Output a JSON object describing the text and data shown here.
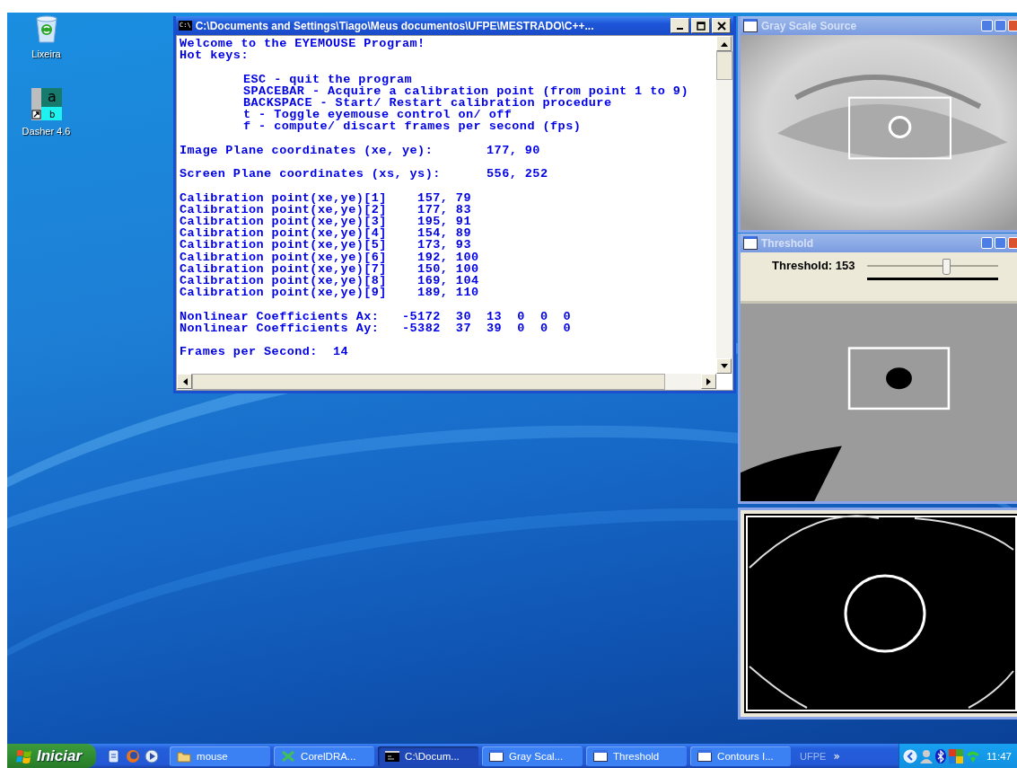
{
  "desktop_icons": [
    {
      "kind": "recycle",
      "label": "Lixeira"
    },
    {
      "kind": "dasher",
      "label": "Dasher 4.6",
      "glyphs": [
        "a",
        "b"
      ]
    }
  ],
  "console": {
    "icon_text": "C:\\",
    "title": "C:\\Documents and Settings\\Tiago\\Meus documentos\\UFPE\\MESTRADO\\C++...",
    "sections": [
      {
        "indent": false,
        "lines": [
          "Welcome to the EYEMOUSE Program!",
          "Hot keys:"
        ]
      },
      {
        "indent": true,
        "lines": [
          "ESC - quit the program",
          "SPACEBAR - Acquire a calibration point (from point 1 to 9)",
          "BACKSPACE - Start/ Restart calibration procedure",
          "t - Toggle eyemouse control on/ off",
          "f - compute/ discart frames per second (fps)"
        ]
      },
      {
        "indent": false,
        "lines": [
          "Image Plane coordinates (xe, ye):       177, 90"
        ]
      },
      {
        "indent": false,
        "lines": [
          "Screen Plane coordinates (xs, ys):      556, 252"
        ]
      },
      {
        "indent": false,
        "lines": [
          "Calibration point(xe,ye)[1]    157, 79",
          "Calibration point(xe,ye)[2]    177, 83",
          "Calibration point(xe,ye)[3]    195, 91",
          "Calibration point(xe,ye)[4]    154, 89",
          "Calibration point(xe,ye)[5]    173, 93",
          "Calibration point(xe,ye)[6]    192, 100",
          "Calibration point(xe,ye)[7]    150, 100",
          "Calibration point(xe,ye)[8]    169, 104",
          "Calibration point(xe,ye)[9]    189, 110"
        ]
      },
      {
        "indent": false,
        "lines": [
          "Nonlinear Coefficients Ax:   -5172  30  13  0  0  0",
          "Nonlinear Coefficients Ay:   -5382  37  39  0  0  0"
        ]
      },
      {
        "indent": false,
        "lines": [
          "Frames per Second:  14"
        ]
      }
    ]
  },
  "gray_window": {
    "title": "Gray Scale Source"
  },
  "threshold_window": {
    "title": "Threshold",
    "trackbar": {
      "label": "Threshold: 153",
      "level": 0.6
    }
  },
  "taskbar": {
    "start": "Iniciar",
    "tasks": [
      {
        "kind": "folder",
        "label": "mouse",
        "selected": false
      },
      {
        "kind": "corel",
        "label": "CorelDRA...",
        "selected": false
      },
      {
        "kind": "console",
        "label": "C:\\Docum...",
        "selected": true
      },
      {
        "kind": "window",
        "label": "Gray Scal...",
        "selected": false
      },
      {
        "kind": "window",
        "label": "Threshold",
        "selected": false
      },
      {
        "kind": "window",
        "label": "Contours I...",
        "selected": false
      }
    ],
    "toolbar_label": "UFPE",
    "chevron": "»",
    "clock": "11:47"
  }
}
